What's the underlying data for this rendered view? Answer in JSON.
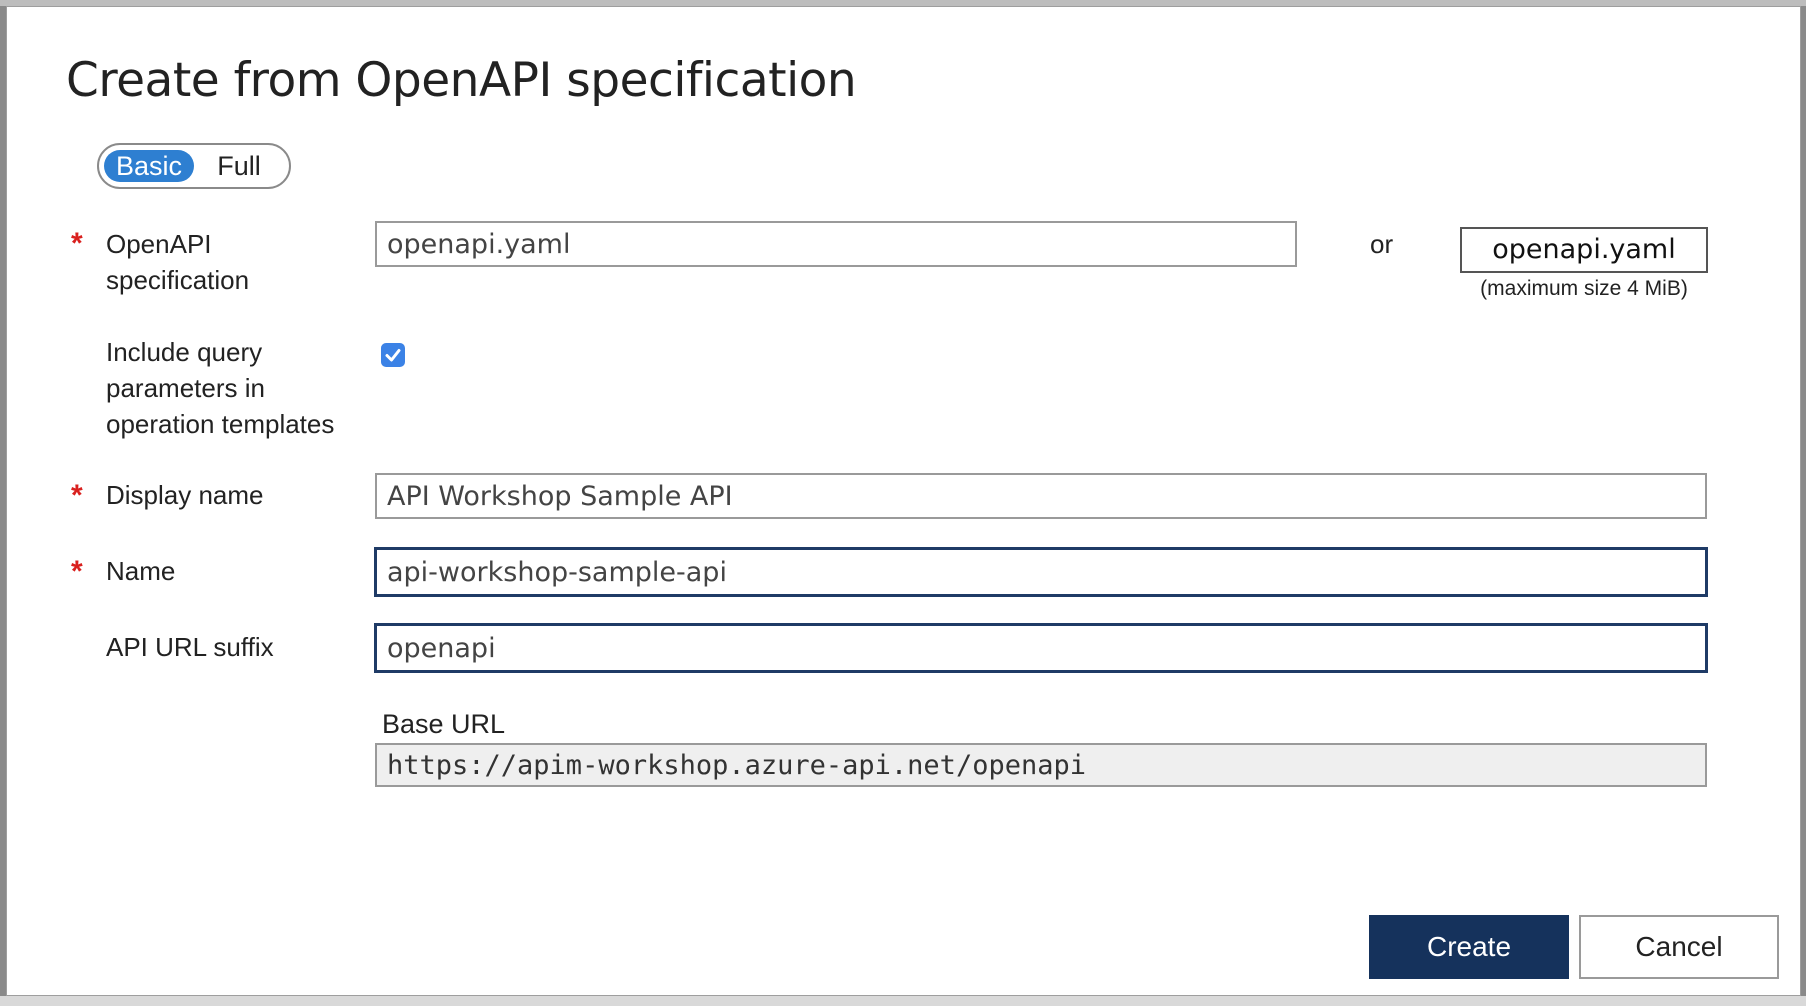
{
  "dialog": {
    "title": "Create from OpenAPI specification"
  },
  "mode_toggle": {
    "options": [
      "Basic",
      "Full"
    ],
    "selected": "Basic"
  },
  "form": {
    "openapi_spec": {
      "label_line1": "OpenAPI",
      "label_line2": "specification",
      "value": "openapi.yaml",
      "or_text": "or",
      "file_button_label": "openapi.yaml",
      "file_hint": "(maximum size 4 MiB)",
      "required": true
    },
    "include_query": {
      "label_line1": "Include query",
      "label_line2": "parameters in",
      "label_line3": "operation templates",
      "checked": true
    },
    "display_name": {
      "label": "Display name",
      "value": "API Workshop Sample API",
      "required": true
    },
    "name": {
      "label": "Name",
      "value": "api-workshop-sample-api",
      "required": true
    },
    "api_url_suffix": {
      "label": "API URL suffix",
      "value": "openapi"
    },
    "base_url": {
      "label": "Base URL",
      "value": "https://apim-workshop.azure-api.net/openapi"
    }
  },
  "actions": {
    "create_label": "Create",
    "cancel_label": "Cancel"
  },
  "colors": {
    "primary": "#15325c",
    "toggle_active": "#2e7fd1",
    "required_asterisk": "#d9201e",
    "checkbox": "#3b82e6"
  },
  "required_marker": "*"
}
